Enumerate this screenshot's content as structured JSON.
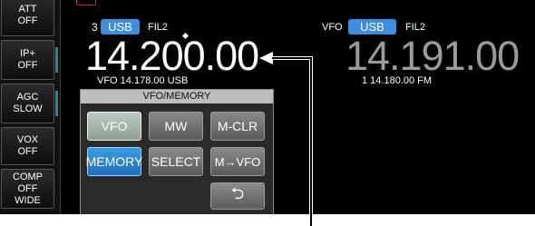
{
  "side_buttons": [
    {
      "label_lines": [
        "ATT",
        "OFF"
      ]
    },
    {
      "label_lines": [
        "IP+",
        "OFF"
      ]
    },
    {
      "label_lines": [
        "AGC",
        "SLOW"
      ]
    },
    {
      "label_lines": [
        "VOX",
        "OFF"
      ]
    },
    {
      "label_lines": [
        "COMP",
        "OFF",
        "WIDE"
      ]
    }
  ],
  "main_vfo": {
    "memory_number": "3",
    "mode": "USB",
    "filter": "FIL2",
    "frequency": "14.200.00",
    "sub_info": "VFO  14.178.00  USB"
  },
  "sub_vfo": {
    "label": "VFO",
    "mode": "USB",
    "filter": "FIL2",
    "frequency": "14.191.00",
    "sub_info": "1  14.180.00  FM"
  },
  "popup": {
    "title": "VFO/MEMORY",
    "buttons": {
      "vfo": "VFO",
      "mw": "MW",
      "mclr": "M-CLR",
      "memory": "MEMORY",
      "select": "SELECT",
      "m_to_vfo": "M→VFO",
      "back": "⮌"
    }
  },
  "colors": {
    "accent": "#3d8ee0",
    "screen_bg": "#000000",
    "sub_frequency": "#9b9b9b",
    "indicator": "#1a8c9a"
  },
  "icons": {
    "back": "return-arrow-icon",
    "callout": "arrow-left-icon"
  }
}
